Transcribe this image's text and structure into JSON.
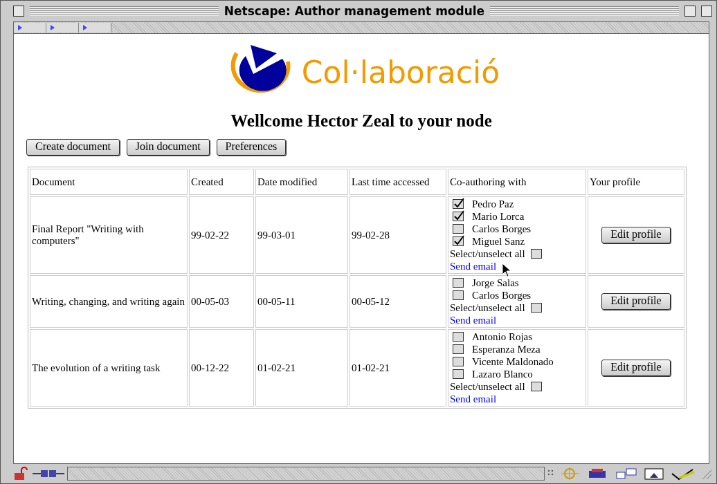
{
  "window": {
    "title": "Netscape: Author management module"
  },
  "logo": {
    "text": "Col·laboració"
  },
  "welcome": "Wellcome Hector Zeal to your node",
  "buttons": [
    "Create document",
    "Join document",
    "Preferences"
  ],
  "table": {
    "columns": [
      "Document",
      "Created",
      "Date modified",
      "Last time accessed",
      "Co-authoring with",
      "Your profile"
    ],
    "rows": [
      {
        "document": "Final Report \"Writing with computers\"",
        "created": "99-02-22",
        "modified": "99-03-01",
        "accessed": "99-02-28",
        "coauthors": [
          {
            "name": "Pedro Paz",
            "checked": true
          },
          {
            "name": "Mario Lorca",
            "checked": true
          },
          {
            "name": "Carlos Borges",
            "checked": false
          },
          {
            "name": "Miguel Sanz",
            "checked": true
          }
        ],
        "select_all": {
          "label": "Select/unselect all",
          "checked": false
        },
        "link": "Send email",
        "button": "Edit profile"
      },
      {
        "document": "Writing, changing, and writing again",
        "created": "00-05-03",
        "modified": "00-05-11",
        "accessed": "00-05-12",
        "coauthors": [
          {
            "name": "Jorge Salas",
            "checked": false
          },
          {
            "name": "Carlos Borges",
            "checked": false
          }
        ],
        "select_all": {
          "label": "Select/unselect all",
          "checked": false
        },
        "link": "Send email",
        "button": "Edit profile"
      },
      {
        "document": "The evolution of a writing task",
        "created": "00-12-22",
        "modified": "01-02-21",
        "accessed": "01-02-21",
        "coauthors": [
          {
            "name": "Antonio Rojas",
            "checked": false
          },
          {
            "name": "Esperanza Meza",
            "checked": false
          },
          {
            "name": "Vicente Maldonado",
            "checked": false
          },
          {
            "name": "Lazaro Blanco",
            "checked": false
          }
        ],
        "select_all": {
          "label": "Select/unselect all",
          "checked": false
        },
        "link": "Send email",
        "button": "Edit profile"
      }
    ]
  }
}
